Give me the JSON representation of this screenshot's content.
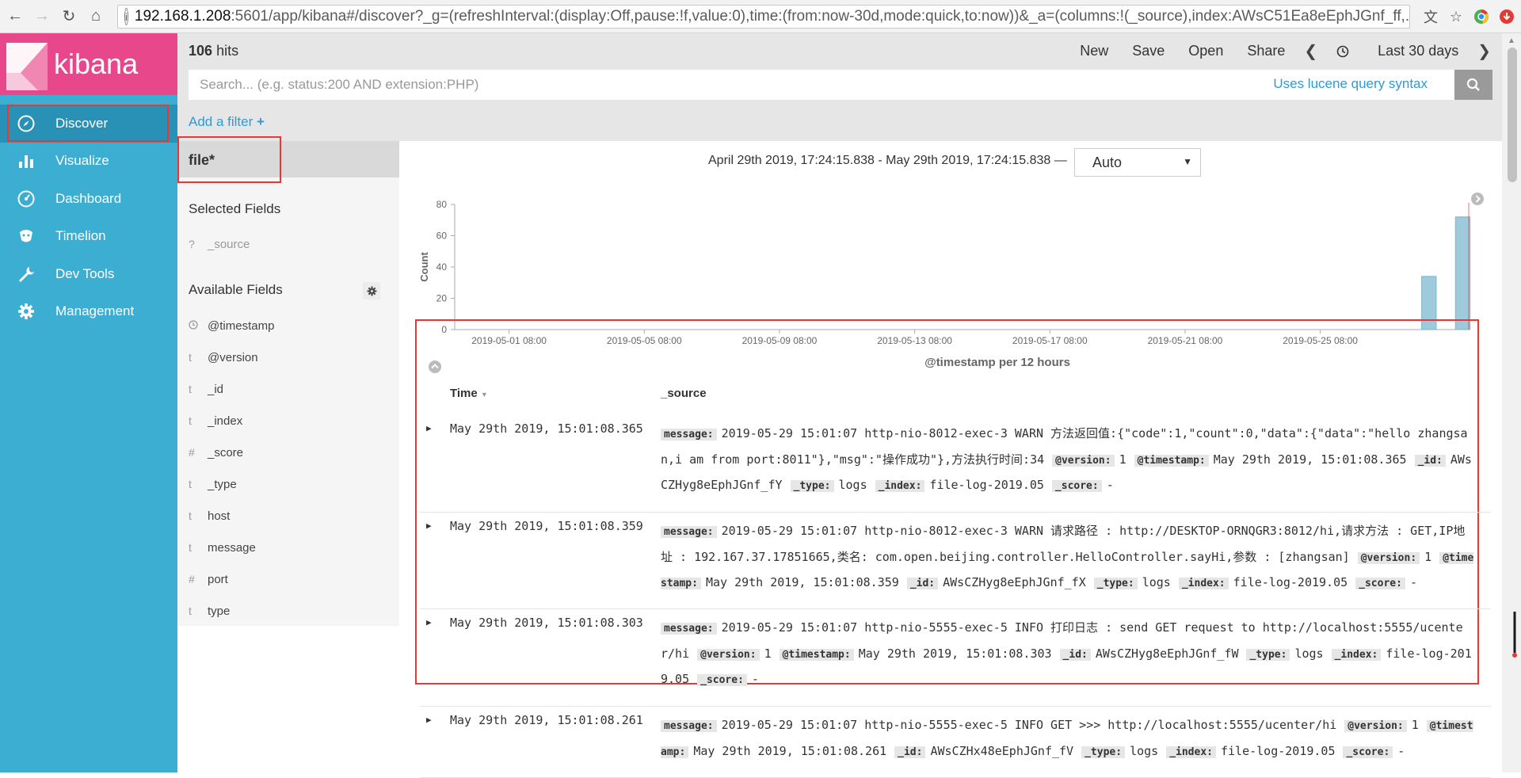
{
  "browser": {
    "url_host": "192.168.1.208",
    "url_rest": ":5601/app/kibana#/discover?_g=(refreshInterval:(display:Off,pause:!f,value:0),time:(from:now-30d,mode:quick,to:now))&_a=(columns:!(_source),index:AWsC51Ea8eEphJGnf_ff,..."
  },
  "app": {
    "logo_text": "kibana",
    "nav": [
      {
        "label": "Discover",
        "icon": "compass-icon",
        "active": true
      },
      {
        "label": "Visualize",
        "icon": "bar-chart-icon",
        "active": false
      },
      {
        "label": "Dashboard",
        "icon": "dashboard-icon",
        "active": false
      },
      {
        "label": "Timelion",
        "icon": "timelion-icon",
        "active": false
      },
      {
        "label": "Dev Tools",
        "icon": "wrench-icon",
        "active": false
      },
      {
        "label": "Management",
        "icon": "gear-icon",
        "active": false
      }
    ]
  },
  "topbar": {
    "hits_count": "106",
    "hits_label": "hits",
    "menu": {
      "new": "New",
      "save": "Save",
      "open": "Open",
      "share": "Share",
      "time": "Last 30 days"
    }
  },
  "search": {
    "placeholder": "Search... (e.g. status:200 AND extension:PHP)",
    "lucene": "Uses lucene query syntax"
  },
  "filter": {
    "add_label": "Add a filter"
  },
  "fields": {
    "index_pattern": "file*",
    "selected_title": "Selected Fields",
    "selected": [
      {
        "type": "?",
        "name": "_source"
      }
    ],
    "available_title": "Available Fields",
    "available": [
      {
        "type": "clock",
        "name": "@timestamp"
      },
      {
        "type": "t",
        "name": "@version"
      },
      {
        "type": "t",
        "name": "_id"
      },
      {
        "type": "t",
        "name": "_index"
      },
      {
        "type": "#",
        "name": "_score"
      },
      {
        "type": "t",
        "name": "_type"
      },
      {
        "type": "t",
        "name": "host"
      },
      {
        "type": "t",
        "name": "message"
      },
      {
        "type": "#",
        "name": "port"
      },
      {
        "type": "t",
        "name": "type"
      }
    ]
  },
  "histogram": {
    "range_text": "April 29th 2019, 17:24:15.838 - May 29th 2019, 17:24:15.838 —",
    "interval": "Auto"
  },
  "chart_data": {
    "type": "bar",
    "xlabel": "@timestamp per 12 hours",
    "ylabel": "Count",
    "ylim": [
      0,
      80
    ],
    "yticks": [
      0,
      20,
      40,
      60,
      80
    ],
    "xticks": [
      "2019-05-01 08:00",
      "2019-05-05 08:00",
      "2019-05-09 08:00",
      "2019-05-13 08:00",
      "2019-05-17 08:00",
      "2019-05-21 08:00",
      "2019-05-25 08:00"
    ],
    "bars": [
      {
        "x": "2019-05-28 08:00",
        "value": 34
      },
      {
        "x": "2019-05-29 08:00",
        "value": 72
      }
    ],
    "grid": false
  },
  "table": {
    "col_time": "Time",
    "col_source": "_source",
    "rows": [
      {
        "time": "May 29th 2019, 15:01:08.365",
        "fields": [
          {
            "k": "message:",
            "v": "2019-05-29 15:01:07 http-nio-8012-exec-3 WARN 方法返回值:{\"code\":1,\"count\":0,\"data\":{\"data\":\"hello zhangsan,i am from port:8011\"},\"msg\":\"操作成功\"},方法执行时间:34"
          },
          {
            "k": "@version:",
            "v": "1"
          },
          {
            "k": "@timestamp:",
            "v": "May 29th 2019, 15:01:08.365"
          },
          {
            "k": "_id:",
            "v": "AWsCZHyg8eEphJGnf_fY"
          },
          {
            "k": "_type:",
            "v": "logs"
          },
          {
            "k": "_index:",
            "v": "file-log-2019.05"
          },
          {
            "k": "_score:",
            "v": "-"
          }
        ]
      },
      {
        "time": "May 29th 2019, 15:01:08.359",
        "fields": [
          {
            "k": "message:",
            "v": "2019-05-29 15:01:07 http-nio-8012-exec-3 WARN 请求路径 : http://DESKTOP-ORNQGR3:8012/hi,请求方法 : GET,IP地址 : 192.167.37.17851665,类名: com.open.beijing.controller.HelloController.sayHi,参数 : [zhangsan]"
          },
          {
            "k": "@version:",
            "v": "1"
          },
          {
            "k": "@timestamp:",
            "v": "May 29th 2019, 15:01:08.359"
          },
          {
            "k": "_id:",
            "v": "AWsCZHyg8eEphJGnf_fX"
          },
          {
            "k": "_type:",
            "v": "logs"
          },
          {
            "k": "_index:",
            "v": "file-log-2019.05"
          },
          {
            "k": "_score:",
            "v": "-"
          }
        ]
      },
      {
        "time": "May 29th 2019, 15:01:08.303",
        "fields": [
          {
            "k": "message:",
            "v": "2019-05-29 15:01:07 http-nio-5555-exec-5 INFO 打印日志 : send GET request to http://localhost:5555/ucenter/hi"
          },
          {
            "k": "@version:",
            "v": "1"
          },
          {
            "k": "@timestamp:",
            "v": "May 29th 2019, 15:01:08.303"
          },
          {
            "k": "_id:",
            "v": "AWsCZHyg8eEphJGnf_fW"
          },
          {
            "k": "_type:",
            "v": "logs"
          },
          {
            "k": "_index:",
            "v": "file-log-2019.05"
          },
          {
            "k": "_score:",
            "v": "-"
          }
        ]
      },
      {
        "time": "May 29th 2019, 15:01:08.261",
        "fields": [
          {
            "k": "message:",
            "v": "2019-05-29 15:01:07 http-nio-5555-exec-5 INFO GET >>> http://localhost:5555/ucenter/hi"
          },
          {
            "k": "@version:",
            "v": "1"
          },
          {
            "k": "@timestamp:",
            "v": "May 29th 2019, 15:01:08.261"
          },
          {
            "k": "_id:",
            "v": "AWsCZHx48eEphJGnf_fV"
          },
          {
            "k": "_type:",
            "v": "logs"
          },
          {
            "k": "_index:",
            "v": "file-log-2019.05"
          },
          {
            "k": "_score:",
            "v": "-"
          }
        ]
      }
    ]
  },
  "colors": {
    "sidebar": "#3caed2",
    "logo": "#e8488b",
    "accent_link": "#2e9bd3",
    "bar": "#9ecbdc",
    "highlight": "#e53935"
  }
}
